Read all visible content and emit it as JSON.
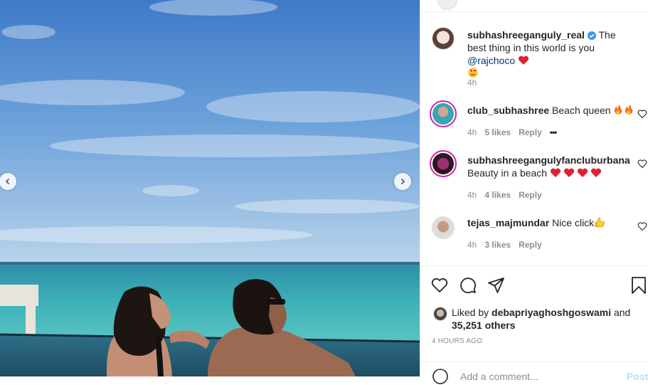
{
  "post": {
    "author": "subhashreeganguly_real",
    "caption": "The best thing in this world is you",
    "mention": "@rajchoco",
    "time": "4h"
  },
  "comments": [
    {
      "user": "club_subhashree",
      "text": "Beach queen",
      "time": "4h",
      "likes": "5 likes",
      "reply": "Reply",
      "more": "•••"
    },
    {
      "user": "subhashreegangulyfancluburbana",
      "text": "Beauty in a beach",
      "time": "4h",
      "likes": "4 likes",
      "reply": "Reply"
    },
    {
      "user": "tejas_majmundar",
      "text": "Nice click",
      "time": "4h",
      "likes": "3 likes",
      "reply": "Reply"
    }
  ],
  "likes": {
    "prefix": "Liked by",
    "user": "debapriyaghoshgoswami",
    "and": "and",
    "count": "35,251 others"
  },
  "timestamp": "4 HOURS AGO",
  "add_comment": {
    "placeholder": "Add a comment...",
    "post": "Post"
  },
  "icons": {
    "prev": "chevron-left-icon",
    "next": "chevron-right-icon",
    "like": "heart-icon",
    "comment": "comment-bubble-icon",
    "share": "paper-plane-icon",
    "save": "bookmark-icon",
    "verified": "verified-badge-icon"
  },
  "colors": {
    "mention": "#00376b",
    "muted": "#8e8e8e",
    "heart": "#ed4956",
    "verified": "#3897f0"
  }
}
